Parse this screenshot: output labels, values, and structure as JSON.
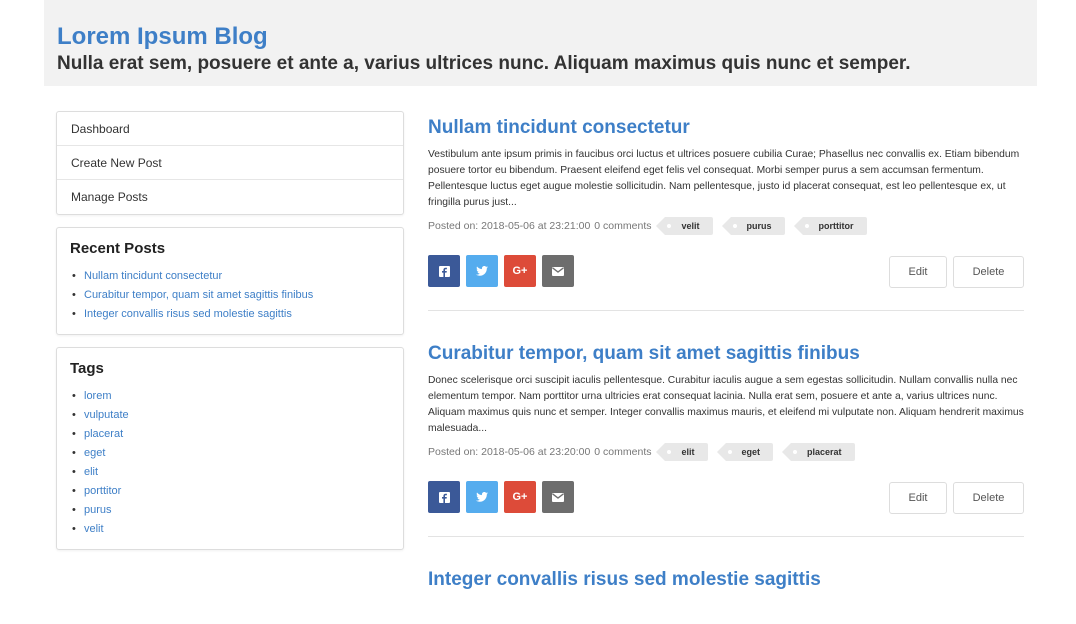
{
  "blog": {
    "title": "Lorem Ipsum Blog",
    "subtitle": "Nulla erat sem, posuere et ante a, varius ultrices nunc. Aliquam maximus quis nunc et semper."
  },
  "menu": [
    {
      "label": "Dashboard"
    },
    {
      "label": "Create New Post"
    },
    {
      "label": "Manage Posts"
    }
  ],
  "recent_posts": {
    "heading": "Recent Posts",
    "items": [
      "Nullam tincidunt consectetur",
      "Curabitur tempor, quam sit amet sagittis finibus",
      "Integer convallis risus sed molestie sagittis"
    ]
  },
  "tags_box": {
    "heading": "Tags",
    "items": [
      "lorem",
      "vulputate",
      "placerat",
      "eget",
      "elit",
      "porttitor",
      "purus",
      "velit"
    ]
  },
  "posts": [
    {
      "title": "Nullam tincidunt consectetur",
      "body": "Vestibulum ante ipsum primis in faucibus orci luctus et ultrices posuere cubilia Curae; Phasellus nec convallis ex. Etiam bibendum posuere tortor eu bibendum. Praesent eleifend eget felis vel consequat. Morbi semper purus a sem accumsan fermentum. Pellentesque luctus eget augue molestie sollicitudin. Nam pellentesque, justo id placerat consequat, est leo pellentesque ex, ut fringilla purus just...",
      "posted": "Posted on: 2018-05-06 at 23:21:00",
      "comments": "0 comments",
      "tags": [
        "velit",
        "purus",
        "porttitor"
      ]
    },
    {
      "title": "Curabitur tempor, quam sit amet sagittis finibus",
      "body": "Donec scelerisque orci suscipit iaculis pellentesque. Curabitur iaculis augue a sem egestas sollicitudin. Nullam convallis nulla nec elementum tempor. Nam porttitor urna ultricies erat consequat lacinia. Nulla erat sem, posuere et ante a, varius ultrices nunc. Aliquam maximus quis nunc et semper. Integer convallis maximus mauris, et eleifend mi vulputate non. Aliquam hendrerit maximus malesuada...",
      "posted": "Posted on: 2018-05-06 at 23:20:00",
      "comments": "0 comments",
      "tags": [
        "elit",
        "eget",
        "placerat"
      ]
    },
    {
      "title": "Integer convallis risus sed molestie sagittis"
    }
  ],
  "buttons": {
    "edit": "Edit",
    "delete": "Delete",
    "google_plus": "G+"
  },
  "colors": {
    "link": "#3e7fc7",
    "facebook": "#3b5998",
    "twitter": "#55acee",
    "google_plus": "#dd4b39",
    "email": "#6d6d6d"
  },
  "icons": {
    "share": [
      "facebook-icon",
      "twitter-icon",
      "google-plus-icon",
      "envelope-icon"
    ]
  }
}
